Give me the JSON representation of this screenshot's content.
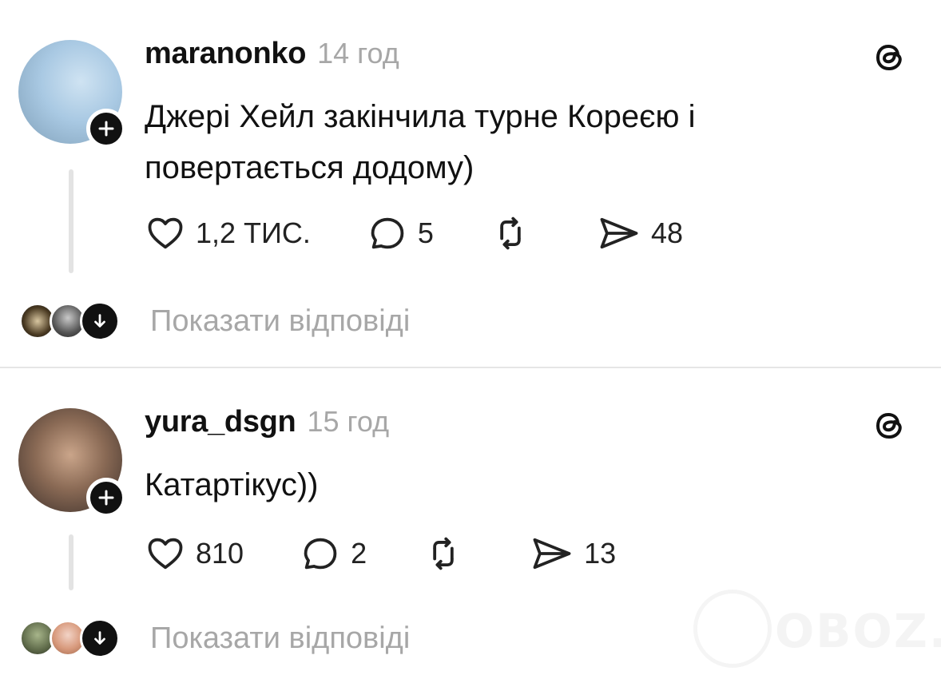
{
  "posts": [
    {
      "username": "maranonko",
      "time": "14 год",
      "text": "Джері Хейл закінчила турне Кореєю і повертається додому)",
      "likes": "1,2 ТИС.",
      "comments": "5",
      "reposts": "",
      "shares": "48",
      "show_replies": "Показати відповіді"
    },
    {
      "username": "yura_dsgn",
      "time": "15 год",
      "text": "Катартікус))",
      "likes": "810",
      "comments": "2",
      "reposts": "",
      "shares": "13",
      "show_replies": "Показати відповіді"
    }
  ],
  "watermark": {
    "text": "OBOZ.UA"
  },
  "icons": {
    "like": "heart-icon",
    "comment": "comment-bubble-icon",
    "repost": "repost-icon",
    "share": "send-icon",
    "brand": "threads-logo-icon",
    "follow": "plus-icon",
    "expand": "arrow-down-icon"
  },
  "colors": {
    "text": "#111111",
    "muted": "#a7a7a7",
    "divider": "#e6e6e6"
  }
}
